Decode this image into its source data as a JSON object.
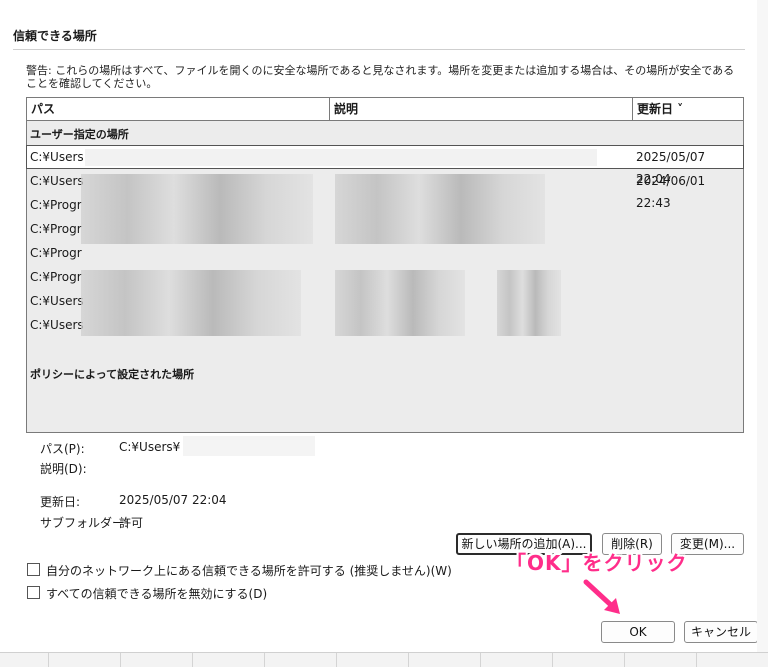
{
  "dialog": {
    "section_title": "信頼できる場所",
    "warning": "警告: これらの場所はすべて、ファイルを開くのに安全な場所であると見なされます。場所を変更または追加する場合は、その場所が安全であることを確認してください。"
  },
  "list": {
    "columns": [
      "パス",
      "説明",
      "更新日 ˅"
    ],
    "user_group_label": "ユーザー指定の場所",
    "rows": [
      {
        "path": "C:¥Users",
        "date": "2025/05/07 22:04"
      },
      {
        "path": "C:¥Users",
        "date": "2024/06/01 22:43"
      },
      {
        "path": "C:¥Progr",
        "date": ""
      },
      {
        "path": "C:¥Progr",
        "date": ""
      },
      {
        "path": "C:¥Progr",
        "date": ""
      },
      {
        "path": "C:¥Progr",
        "date": ""
      },
      {
        "path": "C:¥Users",
        "date": ""
      },
      {
        "path": "C:¥Users",
        "date": ""
      }
    ],
    "policy_group_label": "ポリシーによって設定された場所"
  },
  "details": {
    "path_label": "パス(P):",
    "path_value": "C:¥Users¥",
    "description_label": "説明(D):",
    "modified_label": "更新日:",
    "modified_value": "2025/05/07 22:04",
    "subfolders_label": "サブフォルダー:",
    "subfolders_value": "許可"
  },
  "buttons": {
    "add_new": "新しい場所の追加(A)...",
    "remove": "削除(R)",
    "modify": "変更(M)...",
    "ok": "OK",
    "cancel": "キャンセル"
  },
  "checkboxes": {
    "allow_network": "自分のネットワーク上にある信頼できる場所を許可する (推奨しません)(W)",
    "disable_all": "すべての信頼できる場所を無効にする(D)"
  },
  "annotation": {
    "callout": "「OK」をクリック",
    "color": "#ff2d8a"
  }
}
